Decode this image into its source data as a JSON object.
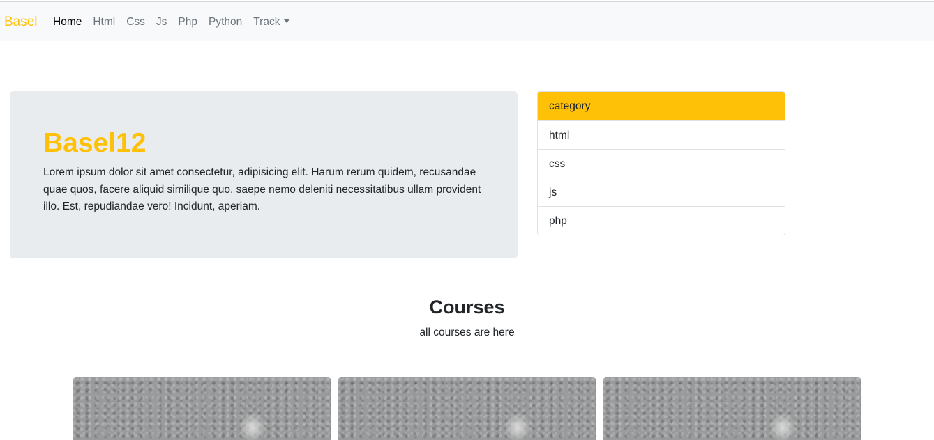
{
  "navbar": {
    "brand": "Basel",
    "links": [
      {
        "label": "Home",
        "active": true
      },
      {
        "label": "Html"
      },
      {
        "label": "Css"
      },
      {
        "label": "Js"
      },
      {
        "label": "Php"
      },
      {
        "label": "Python"
      },
      {
        "label": "Track",
        "dropdown": true
      }
    ]
  },
  "hero": {
    "title": "Basel12",
    "text": "Lorem ipsum dolor sit amet consectetur, adipisicing elit. Harum rerum quidem, recusandae quae quos, facere aliquid similique quo, saepe nemo deleniti necessitatibus ullam provident illo. Est, repudiandae vero! Incidunt, aperiam."
  },
  "category": {
    "header": "category",
    "items": [
      "html",
      "css",
      "js",
      "php"
    ]
  },
  "courses": {
    "title": "Courses",
    "subtitle": "all courses are here"
  },
  "colors": {
    "accent": "#ffc107",
    "navbar_bg": "#f8f9fa",
    "hero_bg": "#e9ecef"
  }
}
